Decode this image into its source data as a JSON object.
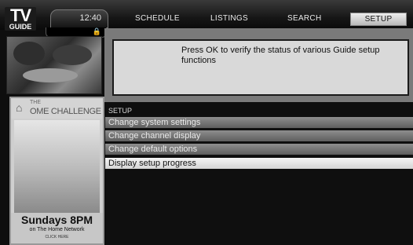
{
  "logo": {
    "tv": "TV",
    "guide": "GUIDE"
  },
  "header": {
    "time": "12:40",
    "menu": [
      {
        "label": "SCHEDULE",
        "active": false
      },
      {
        "label": "LISTINGS",
        "active": false
      },
      {
        "label": "SEARCH",
        "active": false
      },
      {
        "label": "SETUP",
        "active": true
      }
    ]
  },
  "info": {
    "message": "Press OK to verify the status of various Guide setup functions"
  },
  "ad": {
    "title_small": "THE",
    "title_big": "OME CHALLENGE",
    "schedule": "Sundays 8PM",
    "network": "on The Home Network",
    "cta": "CLICK HERE"
  },
  "setup": {
    "section_label": "SETUP",
    "items": [
      {
        "label": "Change system settings",
        "selected": false
      },
      {
        "label": "Change channel display",
        "selected": false
      },
      {
        "label": "Change default options",
        "selected": false
      },
      {
        "label": "Display setup progress",
        "selected": true
      }
    ]
  },
  "icons": {
    "lock": "lock-icon",
    "home": "house-icon"
  }
}
